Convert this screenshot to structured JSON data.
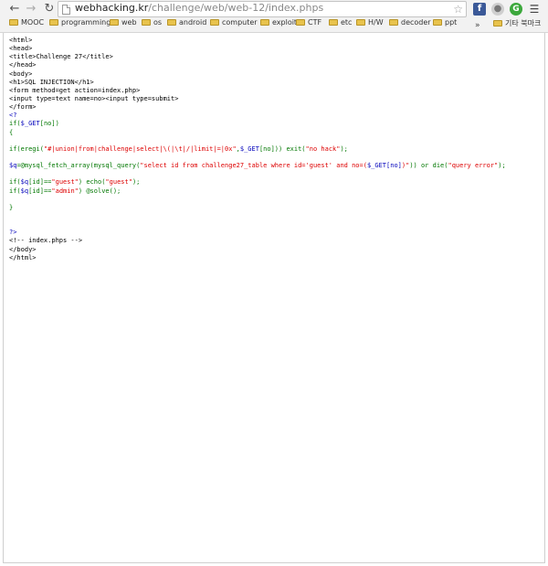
{
  "browser": {
    "url_host": "webhacking.kr",
    "url_path": "/challenge/web/web-12/index.phps",
    "icons": {
      "back": "back-arrow-icon",
      "forward": "forward-arrow-icon",
      "reload": "reload-icon",
      "page": "page-icon",
      "star": "star-icon",
      "facebook": "facebook-icon",
      "menu": "menu-icon"
    },
    "facebook_glyph": "f",
    "green_ext_glyph": "G",
    "bookmarks": [
      "MOOC",
      "programming",
      "web",
      "os",
      "android",
      "computer",
      "exploit",
      "CTF",
      "etc",
      "H/W",
      "decoder",
      "ppt"
    ],
    "bookmark_overflow": "»",
    "other_bookmarks": "기타 북마크"
  },
  "source": {
    "lines": [
      [
        {
          "c": "black",
          "t": "<html>"
        }
      ],
      [
        {
          "c": "black",
          "t": "<head>"
        }
      ],
      [
        {
          "c": "black",
          "t": "<title>Challenge 27</title>"
        }
      ],
      [
        {
          "c": "black",
          "t": "</head>"
        }
      ],
      [
        {
          "c": "black",
          "t": "<body>"
        }
      ],
      [
        {
          "c": "black",
          "t": "<h1>SQL INJECTION</h1>"
        }
      ],
      [
        {
          "c": "black",
          "t": "<form method=get action=index.php>"
        }
      ],
      [
        {
          "c": "black",
          "t": "<input type=text name=no><input type=submit>"
        }
      ],
      [
        {
          "c": "black",
          "t": "</form>"
        }
      ],
      [
        {
          "c": "blue",
          "t": "<?"
        }
      ],
      [
        {
          "c": "green",
          "t": "if("
        },
        {
          "c": "blue",
          "t": "$_GET"
        },
        {
          "c": "green",
          "t": "[no])"
        }
      ],
      [
        {
          "c": "green",
          "t": "{"
        }
      ],
      [],
      [
        {
          "c": "green",
          "t": "if(eregi("
        },
        {
          "c": "red",
          "t": "\"#|union|from|challenge|select|\\(|\\t|/|limit|=|0x\""
        },
        {
          "c": "green",
          "t": ","
        },
        {
          "c": "blue",
          "t": "$_GET"
        },
        {
          "c": "green",
          "t": "[no])) exit("
        },
        {
          "c": "red",
          "t": "\"no hack\""
        },
        {
          "c": "green",
          "t": ");"
        }
      ],
      [],
      [
        {
          "c": "blue",
          "t": "$q"
        },
        {
          "c": "green",
          "t": "=@mysql_fetch_array(mysql_query("
        },
        {
          "c": "red",
          "t": "\"select id from challenge27_table where id='guest' and no=("
        },
        {
          "c": "blue",
          "t": "$_GET[no]"
        },
        {
          "c": "red",
          "t": ")\""
        },
        {
          "c": "green",
          "t": ")) or die("
        },
        {
          "c": "red",
          "t": "\"query error\""
        },
        {
          "c": "green",
          "t": ");"
        }
      ],
      [],
      [
        {
          "c": "green",
          "t": "if("
        },
        {
          "c": "blue",
          "t": "$q"
        },
        {
          "c": "green",
          "t": "[id]=="
        },
        {
          "c": "red",
          "t": "\"guest\""
        },
        {
          "c": "green",
          "t": ") echo("
        },
        {
          "c": "red",
          "t": "\"guest\""
        },
        {
          "c": "green",
          "t": ");"
        }
      ],
      [
        {
          "c": "green",
          "t": "if("
        },
        {
          "c": "blue",
          "t": "$q"
        },
        {
          "c": "green",
          "t": "[id]=="
        },
        {
          "c": "red",
          "t": "\"admin\""
        },
        {
          "c": "green",
          "t": ") @solve();"
        }
      ],
      [],
      [
        {
          "c": "green",
          "t": "}"
        }
      ],
      [],
      [],
      [
        {
          "c": "blue",
          "t": "?>"
        }
      ],
      [
        {
          "c": "black",
          "t": "<!-- index.phps -->"
        }
      ],
      [
        {
          "c": "black",
          "t": "</body>"
        }
      ],
      [
        {
          "c": "black",
          "t": "</html>"
        }
      ]
    ]
  }
}
